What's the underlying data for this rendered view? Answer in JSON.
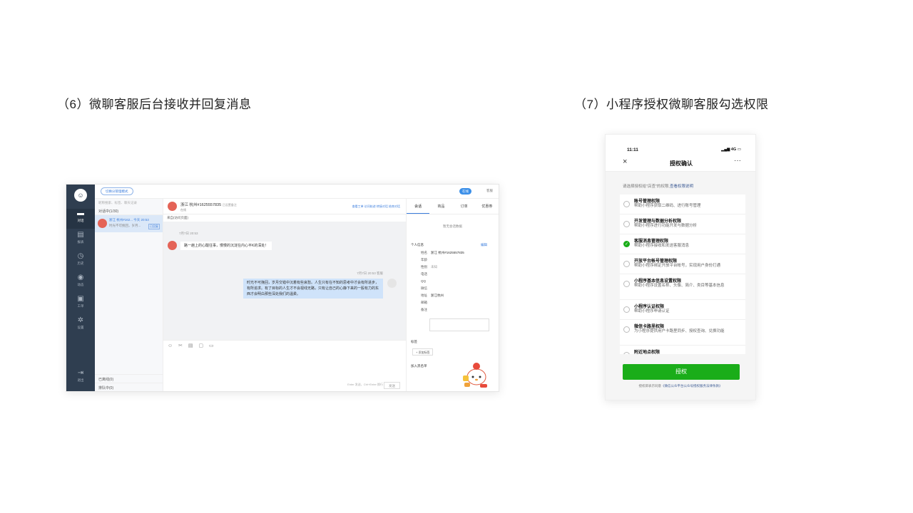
{
  "captions": {
    "left": "（6）微聊客服后台接收并回复消息",
    "right": "（7）小程序授权微聊客服勾选权限"
  },
  "admin": {
    "mode_button": "切换分管理模式",
    "status": "在线",
    "user": "客服",
    "nav": [
      {
        "label": "对话",
        "icon": "chat-icon"
      },
      {
        "label": "报表",
        "icon": "report-icon"
      },
      {
        "label": "历史",
        "icon": "history-icon"
      },
      {
        "label": "动态",
        "icon": "activity-icon"
      },
      {
        "label": "工单",
        "icon": "ticket-icon"
      },
      {
        "label": "设置",
        "icon": "settings-icon"
      }
    ],
    "exit_label": "退出",
    "search_placeholder": "昵称搜索、标签、聊天记录",
    "dialog_count": "对话中(1/30)",
    "conversation": {
      "name": "浙江 杭州#162...",
      "time": "今天 20:53",
      "preview": "时光不可挽回，岁月...",
      "tag": "已回复"
    },
    "ended": "已离线(0)",
    "queue": "排队中(0)",
    "chat_header": {
      "name": "浙江 杭州#1625557835",
      "remark": "已设置备注",
      "state": "在线",
      "ops": "查看工单 访问轨迹 转接对话 结束对话"
    },
    "source": "来自(访问页面)",
    "msg_in_time": "7月7日 20:53",
    "msg_in": "路一趟上的心酸往事，慢慢的沉淀在内心平K的深处！",
    "msg_out_time": "7月7日 20:53  客服",
    "msg_out": "时光不可挽回，岁月交错中沉着有些哀愁。人生只有在不知的思考中才会有所进步，有所追求。有了目标的人生才不会视线无路，只有让自己的心静下来的一股有力的东西才会明白那些深处我们的温柔。",
    "tools": "☺ ✂ ▤ ▢ ▭",
    "input_hint": "Enter 发送，Ctrl+Enter 换行",
    "send": "发送",
    "tabs": [
      "会话",
      "商品",
      "订单",
      "优惠券"
    ],
    "no_data": "暂无会话数据",
    "profile_title": "个人信息",
    "profile_edit": "编辑",
    "fields": [
      {
        "k": "姓名",
        "v": "浙江 杭州#1625557835"
      },
      {
        "k": "年龄",
        "v": ""
      },
      {
        "k": "性别",
        "v": "未知"
      },
      {
        "k": "电话",
        "v": ""
      },
      {
        "k": "QQ",
        "v": ""
      },
      {
        "k": "微信",
        "v": ""
      },
      {
        "k": "地址",
        "v": "浙江杭州"
      },
      {
        "k": "邮箱",
        "v": ""
      },
      {
        "k": "备注",
        "v": ""
      }
    ],
    "tags_title": "标签",
    "add_tag": "+ 添加标签",
    "blacklist": "加入黑名单"
  },
  "phone": {
    "time": "11:11",
    "signal": "4G",
    "title": "授权确认",
    "desc": "请选择授权给\"店查\"的权限,",
    "desc_link": "查看权限说明",
    "permissions": [
      {
        "title": "账号管理权限",
        "desc": "帮助小程序获取二维码、进行账号管理",
        "checked": false
      },
      {
        "title": "开发管理与数据分析权限",
        "desc": "帮助小程序进行功能开发与数据分析",
        "checked": false
      },
      {
        "title": "客服消息管理权限",
        "desc": "帮助小程序接收和发送客服消息",
        "checked": true
      },
      {
        "title": "开放平台帐号管理权限",
        "desc": "帮助小程序绑定开放平台帐号，实现用户身份打通",
        "checked": false
      },
      {
        "title": "小程序基本信息设置权限",
        "desc": "帮助小程序设置名称、头像、简介、类目等基本信息",
        "checked": false
      },
      {
        "title": "小程序认证权限",
        "desc": "帮助小程序申请认证",
        "checked": false
      },
      {
        "title": "微信卡路里权限",
        "desc": "为小程序提供用户卡路里同步、授权查询、兑换功能",
        "checked": false
      },
      {
        "title": "附近地点权限",
        "desc": "",
        "checked": false
      }
    ],
    "button": "授权",
    "agree": "授权即表示同意",
    "agree_link": "《微信公众平台公众号授权服务法律条款》"
  }
}
